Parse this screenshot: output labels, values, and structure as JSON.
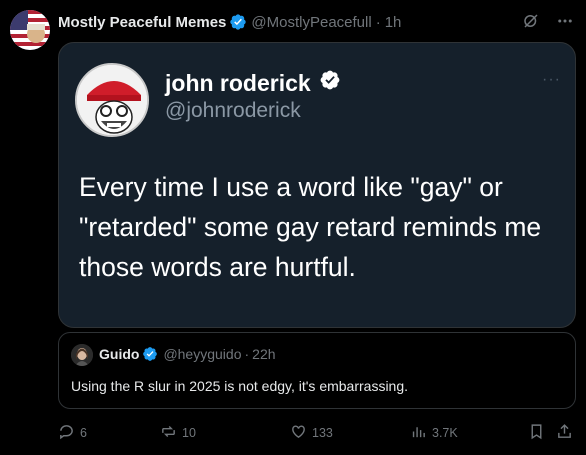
{
  "post": {
    "author_name": "Mostly Peaceful Memes",
    "author_handle": "@MostlyPeacefull",
    "separator": "·",
    "time": "1h"
  },
  "image": {
    "name": "john roderick",
    "handle": "@johnroderick",
    "more": "···",
    "text": "Every time I use a word like \"gay\" or \"retarded\" some gay retard reminds me those words are hurtful."
  },
  "quote": {
    "name": "Guido",
    "handle": "@heyyguido",
    "separator": "·",
    "time": "22h",
    "text": "Using the R slur in 2025 is not edgy, it's embarrassing."
  },
  "actions": {
    "replies": "6",
    "reposts": "10",
    "likes": "133",
    "views": "3.7K"
  },
  "colors": {
    "accent": "#1d9bf0",
    "muted": "#71767b",
    "card_bg": "#15202b"
  },
  "icons": [
    "verified-badge-icon",
    "grok-icon",
    "more-icon",
    "reply-icon",
    "repost-icon",
    "like-icon",
    "views-icon",
    "bookmark-icon",
    "share-icon"
  ]
}
